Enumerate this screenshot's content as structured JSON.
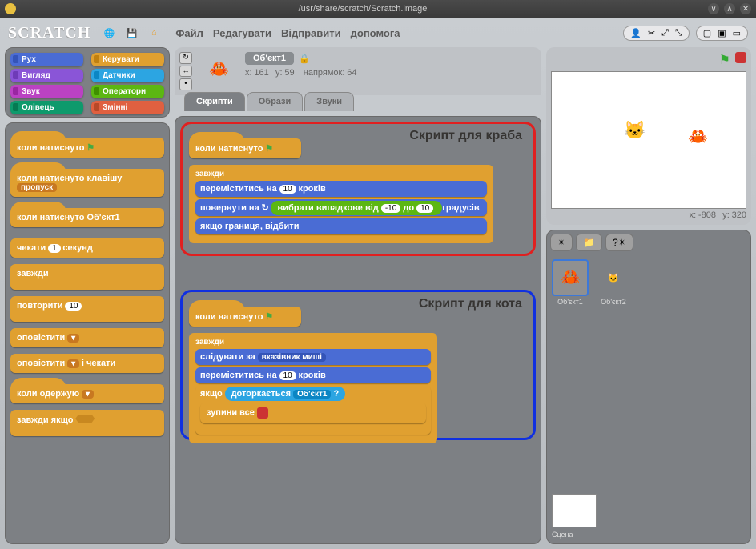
{
  "window": {
    "title": "/usr/share/scratch/Scratch.image"
  },
  "app": {
    "logo": "SCRATCH"
  },
  "menu": {
    "file": "Файл",
    "edit": "Редагувати",
    "share": "Відправити",
    "help": "допомога"
  },
  "categories": [
    {
      "label": "Рух",
      "bg": "#4a6cd4",
      "edge": "#3454b8"
    },
    {
      "label": "Керувати",
      "bg": "#e0a030",
      "edge": "#c08010"
    },
    {
      "label": "Вигляд",
      "bg": "#8a55d7",
      "edge": "#6e3bb8"
    },
    {
      "label": "Датчики",
      "bg": "#2ca5e2",
      "edge": "#0b86c4"
    },
    {
      "label": "Звук",
      "bg": "#bb42c3",
      "edge": "#9a26a2"
    },
    {
      "label": "Оператори",
      "bg": "#5cb712",
      "edge": "#3f8e00"
    },
    {
      "label": "Олівець",
      "bg": "#0e9a6c",
      "edge": "#057a52"
    },
    {
      "label": "Змінні",
      "bg": "#e06040",
      "edge": "#b84828"
    }
  ],
  "palette": {
    "when_flag": "коли натиснуто",
    "when_key": "коли натиснуто клавішу",
    "when_key_arg": "пропуск",
    "when_sprite": "коли натиснуто Об'єкт1",
    "wait": "чекати",
    "wait_arg": "1",
    "wait_suffix": "секунд",
    "forever": "завжди",
    "repeat": "повторити",
    "repeat_arg": "10",
    "broadcast": "оповістити",
    "broadcast_wait": "оповістити",
    "broadcast_wait_suffix": "і чекати",
    "receive": "коли одержую",
    "forever_if": "завжди якщо"
  },
  "sprite_info": {
    "name": "Об'єкт1",
    "x_lbl": "x:",
    "x": "161",
    "y_lbl": "y:",
    "y": "59",
    "dir_lbl": "напрямок:",
    "dir": "64"
  },
  "tabs": {
    "scripts": "Скрипти",
    "costumes": "Образи",
    "sounds": "Звуки"
  },
  "script1": {
    "title": "Скрипт для краба",
    "hat": "коли натиснуто",
    "forever": "завжди",
    "move": "переміститись на",
    "move_n": "10",
    "move_suffix": "кроків",
    "turn": "повернути на",
    "rand": "вибрати випадкове від",
    "rand_a": "-10",
    "rand_mid": "до",
    "rand_b": "10",
    "turn_suffix": "градусів",
    "bounce": "якщо границя, відбити"
  },
  "script2": {
    "title": "Скрипт для кота",
    "hat": "коли натиснуто",
    "forever": "завжди",
    "point": "слідувати за",
    "point_arg": "вказівник миші",
    "move": "переміститись на",
    "move_n": "10",
    "move_suffix": "кроків",
    "if": "якщо",
    "touch": "доторкається",
    "touch_arg": "Об'єкт1",
    "q": "?",
    "stop": "зупини все"
  },
  "stage": {
    "coords_x_lbl": "x:",
    "coords_x": "-808",
    "coords_y_lbl": "y:",
    "coords_y": "320",
    "label": "Сцена"
  },
  "sprites": [
    {
      "name": "Об'єкт1"
    },
    {
      "name": "Об'єкт2"
    }
  ]
}
